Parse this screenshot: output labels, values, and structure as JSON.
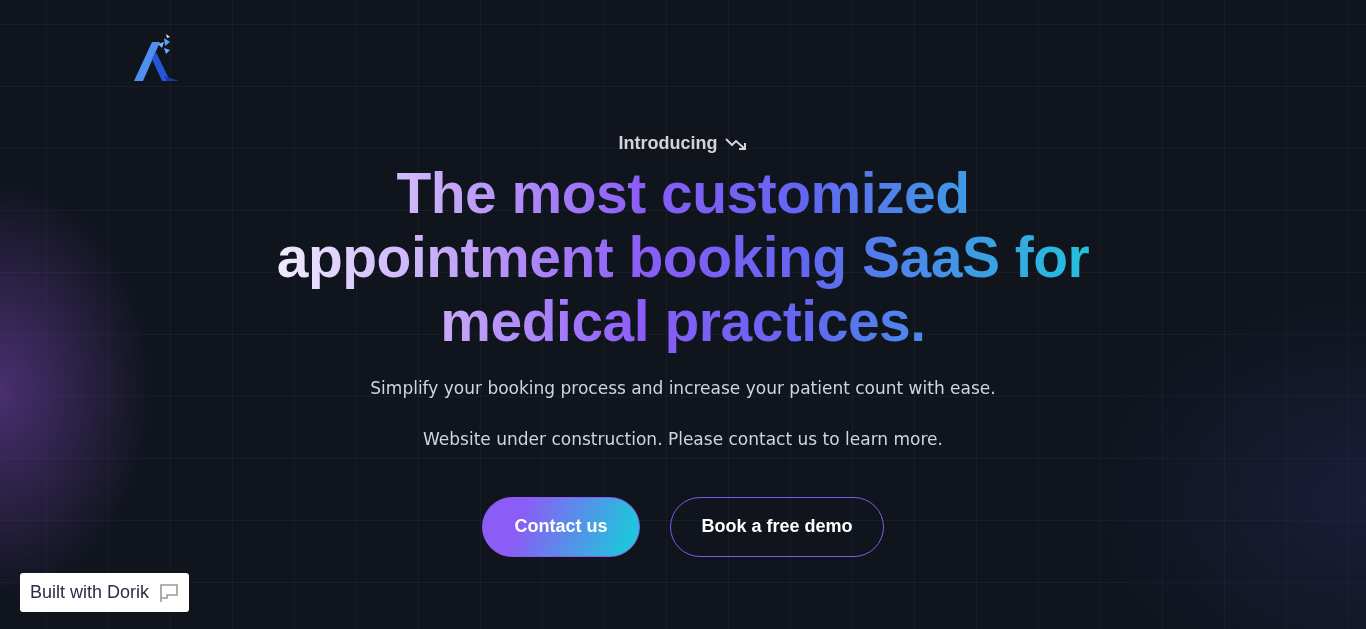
{
  "hero": {
    "eyebrow": "Introducing",
    "headline": "The most customized appointment booking SaaS for medical practices.",
    "subtitle": "Simplify your booking process and increase your patient count with ease.",
    "note": "Website under construction. Please contact us to learn more.",
    "buttons": [
      {
        "label": "Contact us",
        "kind": "primary"
      },
      {
        "label": "Book a free demo",
        "kind": "outline"
      }
    ]
  },
  "badge": {
    "label": "Built with Dorik"
  }
}
